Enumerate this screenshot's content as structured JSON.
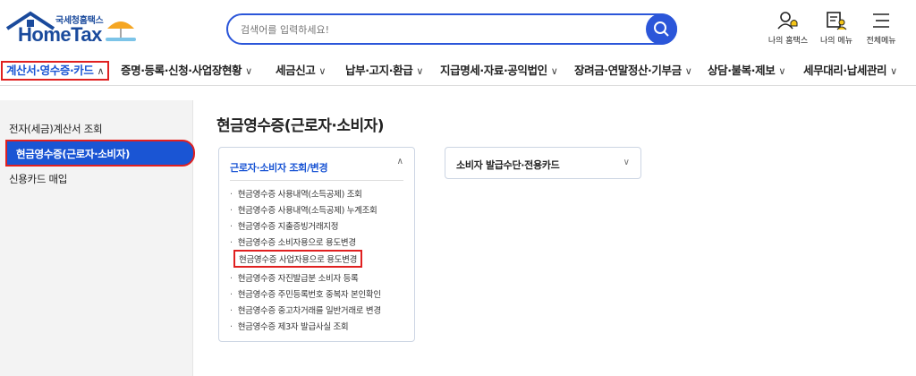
{
  "header": {
    "logo_small": "국세청홈택스",
    "logo_big": "HomeTax",
    "search_placeholder": "검색어를 입력하세요!",
    "utils": [
      {
        "label": "나의 홈택스",
        "icon": "person-bell-icon"
      },
      {
        "label": "나의 메뉴",
        "icon": "my-menu-icon"
      },
      {
        "label": "전체메뉴",
        "icon": "hamburger-icon"
      }
    ]
  },
  "nav": {
    "items": [
      {
        "label": "계산서·영수증·카드",
        "chev": "∧"
      },
      {
        "label": "증명·등록·신청·사업장현황",
        "chev": "∨"
      },
      {
        "label": "세금신고",
        "chev": "∨"
      },
      {
        "label": "납부·고지·환급",
        "chev": "∨"
      },
      {
        "label": "지급명세·자료·공익법인",
        "chev": "∨"
      },
      {
        "label": "장려금·연말정산·기부금",
        "chev": "∨"
      },
      {
        "label": "상담·불복·제보",
        "chev": "∨"
      },
      {
        "label": "세무대리·납세관리",
        "chev": "∨"
      }
    ]
  },
  "sidebar": {
    "items": [
      {
        "label": "전자(세금)계산서 조회"
      },
      {
        "label": "현금영수증(근로자·소비자)"
      },
      {
        "label": "신용카드 매입"
      }
    ]
  },
  "main": {
    "title": "현금영수증(근로자·소비자)",
    "card1": {
      "title": "근로자·소비자 조회/변경",
      "chev": "∧",
      "items": [
        "현금영수증 사용내역(소득공제) 조회",
        "현금영수증 사용내역(소득공제) 누계조회",
        "현금영수증 지출증빙거래지정",
        "현금영수증 소비자용으로 용도변경",
        "현금영수증 사업자용으로 용도변경",
        "현금영수증 자진발급분 소비자 등록",
        "현금영수증 주민등록번호 중복자 본인확인",
        "현금영수증 중고차거래를 일반거래로 변경",
        "현금영수증 제3자 발급사실 조회"
      ]
    },
    "card2": {
      "title": "소비자 발급수단·전용카드",
      "chev": "∨"
    }
  },
  "colors": {
    "accent": "#1a55d4",
    "highlight": "#e02020"
  }
}
